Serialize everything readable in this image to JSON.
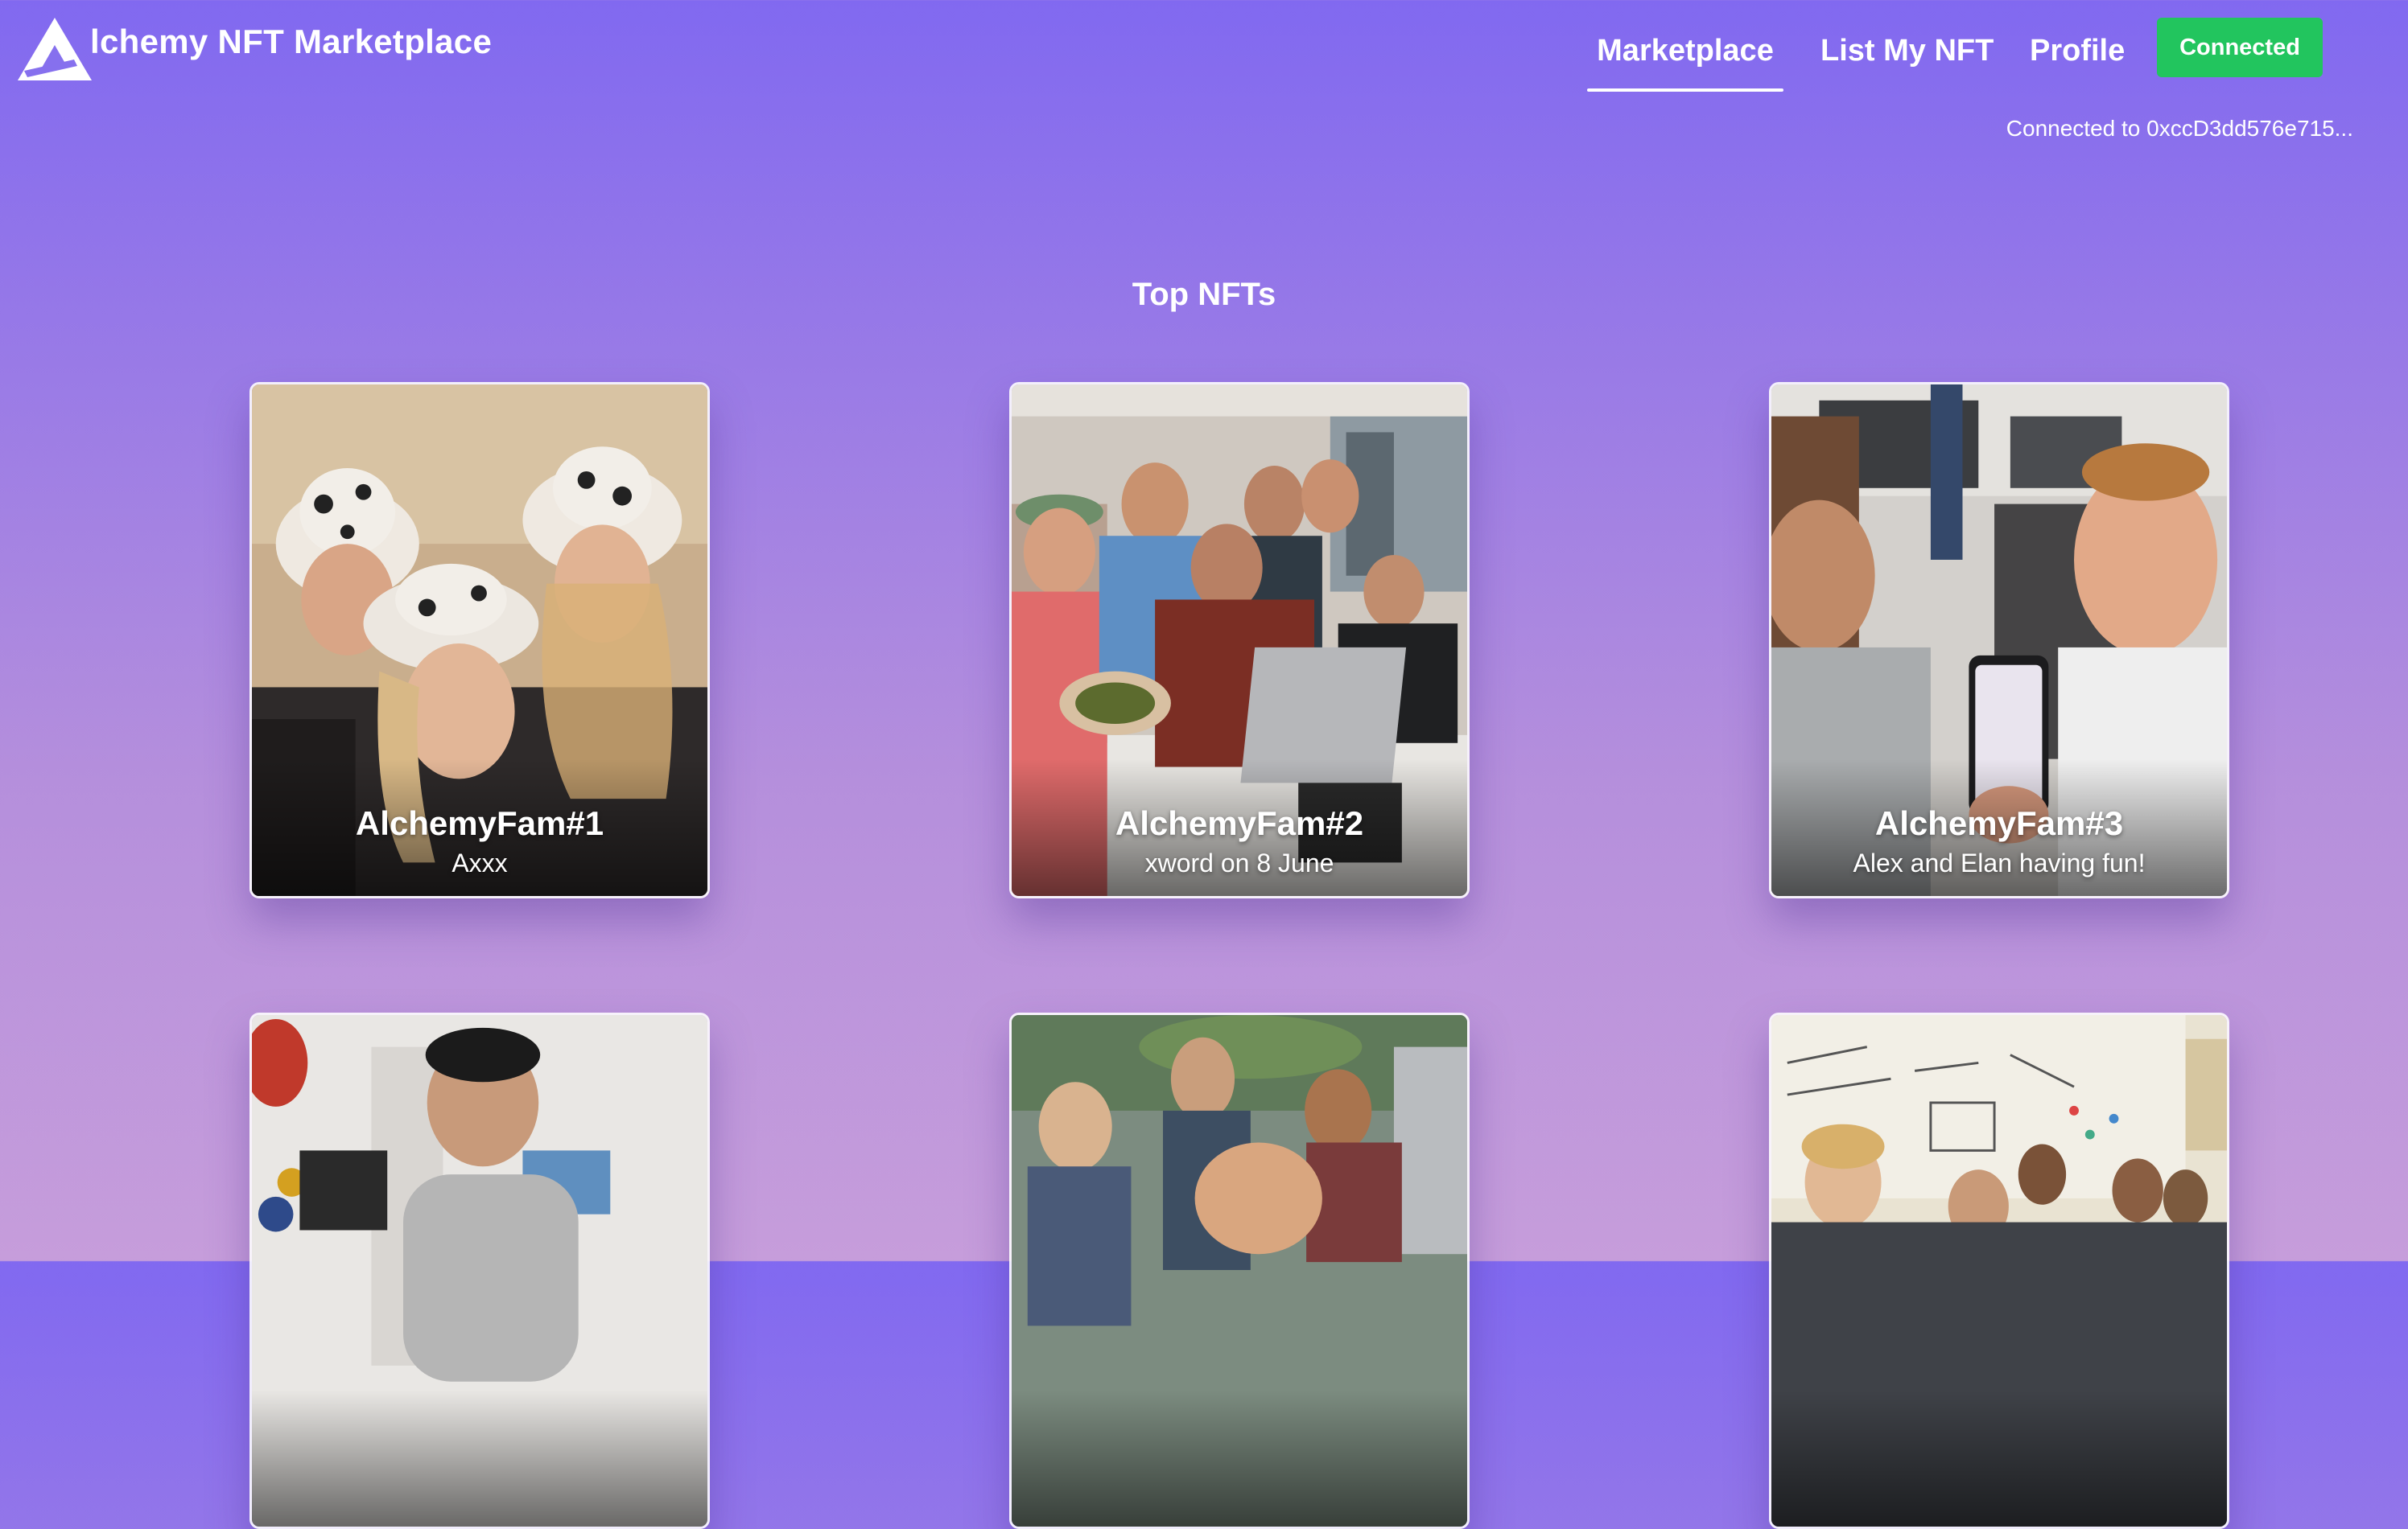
{
  "header": {
    "brand": "lchemy NFT Marketplace",
    "logo_icon": "alchemy-logo-icon",
    "nav": [
      {
        "label": "Marketplace",
        "active": true
      },
      {
        "label": "List My NFT",
        "active": false
      },
      {
        "label": "Profile",
        "active": false
      }
    ],
    "connect_button": "Connected",
    "connect_color": "#22c55e",
    "status": "Connected to 0xccD3dd576e715..."
  },
  "main": {
    "heading": "Top NFTs",
    "cards": [
      {
        "title": "AlchemyFam#1",
        "description": "Axxx"
      },
      {
        "title": "AlchemyFam#2",
        "description": "xword on 8 June"
      },
      {
        "title": "AlchemyFam#3",
        "description": "Alex and Elan having fun!"
      },
      {
        "title": "",
        "description": ""
      },
      {
        "title": "",
        "description": ""
      },
      {
        "title": "",
        "description": ""
      }
    ]
  },
  "colors": {
    "background_top": "#8169f0",
    "background_bottom": "#c69ddb",
    "text": "#ffffff"
  }
}
